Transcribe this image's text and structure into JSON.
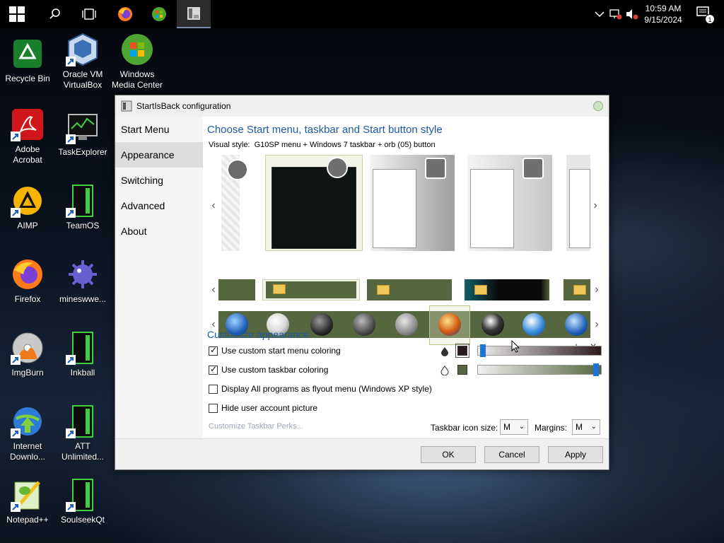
{
  "taskbar": {
    "clock_time": "10:59 AM",
    "clock_date": "9/15/2024",
    "notification_count": "1"
  },
  "desktop": {
    "icons": [
      {
        "label": "Recycle Bin",
        "icon": "recycle-bin-icon"
      },
      {
        "label": "Oracle VM VirtualBox",
        "icon": "virtualbox-icon"
      },
      {
        "label": "Windows Media Center",
        "icon": "media-center-icon"
      },
      {
        "label": "Adobe Acrobat",
        "icon": "acrobat-icon"
      },
      {
        "label": "TaskExplorer",
        "icon": "taskexplorer-icon"
      },
      {
        "label": "AIMP",
        "icon": "aimp-icon"
      },
      {
        "label": "TeamOS",
        "icon": "teamos-icon"
      },
      {
        "label": "Firefox",
        "icon": "firefox-icon"
      },
      {
        "label": "mineswwe...",
        "icon": "minesweeper-icon"
      },
      {
        "label": "ImgBurn",
        "icon": "imgburn-icon"
      },
      {
        "label": "Inkball",
        "icon": "inkball-icon"
      },
      {
        "label": "Internet Downlo...",
        "icon": "internet-download-icon"
      },
      {
        "label": "ATT Unlimited...",
        "icon": "att-unlimited-icon"
      },
      {
        "label": "Notepad++",
        "icon": "notepadpp-icon"
      },
      {
        "label": "SoulseekQt",
        "icon": "soulseek-icon"
      }
    ]
  },
  "dialog": {
    "title": "StartIsBack configuration",
    "nav": [
      "Start Menu",
      "Appearance",
      "Switching",
      "Advanced",
      "About"
    ],
    "heading": "Choose Start menu, taskbar and Start button style",
    "visual_style_label": "Visual style:",
    "visual_style_value": "G10SP menu + Windows 7 taskbar + orb (05) button",
    "customize_heading": "Customize appearance",
    "options": [
      {
        "label": "Use custom start menu coloring",
        "checked": true
      },
      {
        "label": "Use custom taskbar coloring",
        "checked": true
      },
      {
        "label": "Display All programs as flyout menu (Windows XP style)",
        "checked": false
      },
      {
        "label": "Hide user account picture",
        "checked": false
      }
    ],
    "perks_link": "Customize Taskbar Perks...",
    "taskbar_icon_size_label": "Taskbar icon size:",
    "taskbar_icon_size_value": "M",
    "margins_label": "Margins:",
    "margins_value": "M",
    "start_menu_color": "#2a1a1c",
    "start_menu_slider_level": 0.02,
    "taskbar_color": "#56663f",
    "taskbar_slider_level": 0.98,
    "buttons": {
      "ok": "OK",
      "cancel": "Cancel",
      "apply": "Apply"
    },
    "plus_glyph": "+",
    "close_glyph": "×"
  }
}
